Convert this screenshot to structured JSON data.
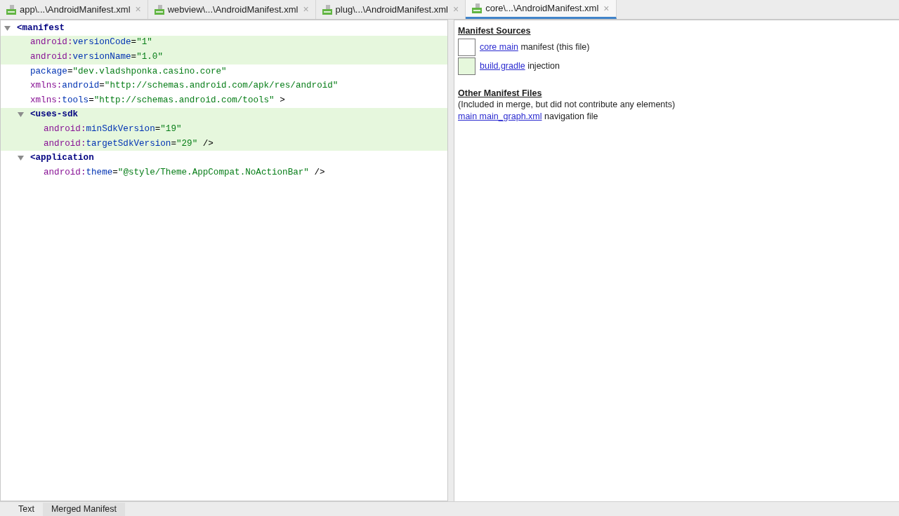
{
  "tabs": [
    {
      "label": "app\\...\\AndroidManifest.xml",
      "close": "×",
      "selected": false
    },
    {
      "label": "webview\\...\\AndroidManifest.xml",
      "close": "×",
      "selected": false
    },
    {
      "label": "plug\\...\\AndroidManifest.xml",
      "close": "×",
      "selected": false
    },
    {
      "label": "core\\...\\AndroidManifest.xml",
      "close": "×",
      "selected": true
    }
  ],
  "tree": [
    {
      "open": "<manifest",
      "expanded": true,
      "highlighted": false,
      "attributes": [
        {
          "prefix": "android:",
          "name": "versionCode",
          "eq": "=",
          "value": "\"1\"",
          "highlighted": true
        },
        {
          "prefix": "android:",
          "name": "versionName",
          "eq": "=",
          "value": "\"1.0\"",
          "highlighted": true
        },
        {
          "name": "package",
          "eq": "=",
          "value": "\"dev.vladshponka.casino.core\"",
          "highlighted": false
        },
        {
          "prefix": "xmlns:",
          "name": "android",
          "eq": "=",
          "value": "\"http://schemas.android.com/apk/res/android\"",
          "highlighted": false
        },
        {
          "prefix": "xmlns:",
          "name": "tools",
          "eq": "=",
          "value": "\"http://schemas.android.com/tools\"",
          "end": " >",
          "highlighted": false
        }
      ],
      "children": [
        {
          "open": "<uses-sdk",
          "expanded": true,
          "highlighted": true,
          "attributes": [
            {
              "prefix": "android:",
              "name": "minSdkVersion",
              "eq": "=",
              "value": "\"19\"",
              "highlighted": true
            },
            {
              "prefix": "android:",
              "name": "targetSdkVersion",
              "eq": "=",
              "value": "\"29\"",
              "end": " />",
              "highlighted": true
            }
          ]
        },
        {
          "open": "<application",
          "expanded": true,
          "highlighted": false,
          "attributes": [
            {
              "prefix": "android:",
              "name": "theme",
              "eq": "=",
              "value": "\"@style/Theme.AppCompat.NoActionBar\"",
              "end": " />",
              "highlighted": false
            }
          ]
        }
      ]
    }
  ],
  "manifest_sources": {
    "title": "Manifest Sources",
    "items": [
      {
        "color": "#ffffff",
        "link": "core main",
        "text": "manifest (this file)"
      },
      {
        "color": "#e6f8dc",
        "link": "build.gradle",
        "text": "injection"
      }
    ]
  },
  "other_files": {
    "title": "Other Manifest Files",
    "note": "(Included in merge, but did not contribute any elements)",
    "items": [
      {
        "link": "main main_graph.xml",
        "text": "navigation file"
      }
    ]
  },
  "bottom_tabs": [
    {
      "label": "Text",
      "selected": false
    },
    {
      "label": "Merged Manifest",
      "selected": true
    }
  ]
}
